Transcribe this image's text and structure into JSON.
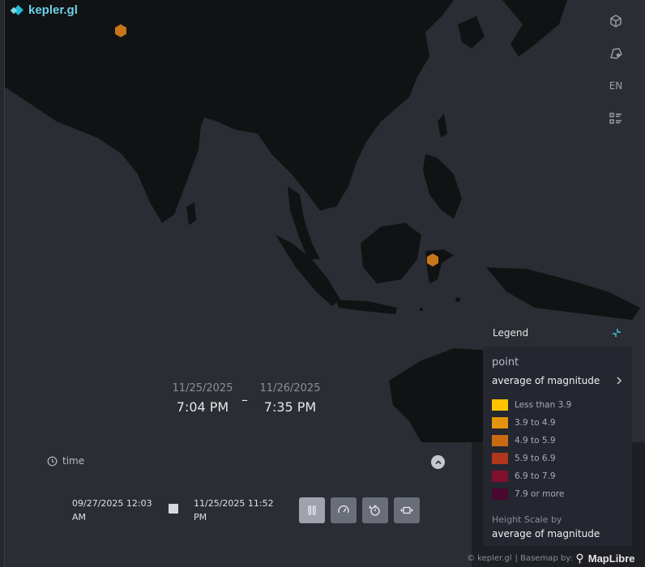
{
  "app": {
    "logo_text": "kepler.gl"
  },
  "toolbar": {
    "buttons": [
      {
        "icon": "3d-cube-icon"
      },
      {
        "icon": "draw-polygon-icon"
      },
      {
        "icon": "locale-icon",
        "label": "EN"
      },
      {
        "icon": "map-legend-icon"
      }
    ]
  },
  "map": {
    "markers": [
      {
        "icon": "hexagon-marker-icon",
        "color": "#c8761a"
      },
      {
        "icon": "hexagon-marker-icon",
        "color": "#c8761a"
      }
    ],
    "colors": {
      "land": "#111214",
      "water": "#2a2d33"
    }
  },
  "time_display": {
    "start_date": "11/25/2025",
    "start_time": "7:04 PM",
    "separator": "–",
    "end_date": "11/26/2025",
    "end_time": "7:35 PM"
  },
  "time_filter": {
    "label": "time",
    "range_start": "09/27/2025 12:03 AM",
    "range_end": "11/25/2025 11:52 PM"
  },
  "playback": {
    "buttons": [
      {
        "icon": "pause-icon",
        "active": true
      },
      {
        "icon": "speed-icon",
        "active": false
      },
      {
        "icon": "reset-timer-icon",
        "active": false
      },
      {
        "icon": "animation-window-icon",
        "active": false
      }
    ]
  },
  "legend": {
    "header": "Legend",
    "layer_name": "point",
    "color_field": "average of magnitude",
    "entries": [
      {
        "label": "Less than 3.9",
        "color": "#ffc300"
      },
      {
        "label": "3.9 to 4.9",
        "color": "#e3940d"
      },
      {
        "label": "4.9 to 5.9",
        "color": "#c86a12"
      },
      {
        "label": "5.9 to 6.9",
        "color": "#b0361c"
      },
      {
        "label": "6.9 to 7.9",
        "color": "#80102c"
      },
      {
        "label": "7.9 or more",
        "color": "#4a0830"
      }
    ],
    "height_scale_label": "Height Scale by",
    "height_scale_field": "average of magnitude"
  },
  "attribution": {
    "copyright": "© kepler.gl",
    "basemap": "| Basemap by:",
    "provider": "MapLibre"
  }
}
